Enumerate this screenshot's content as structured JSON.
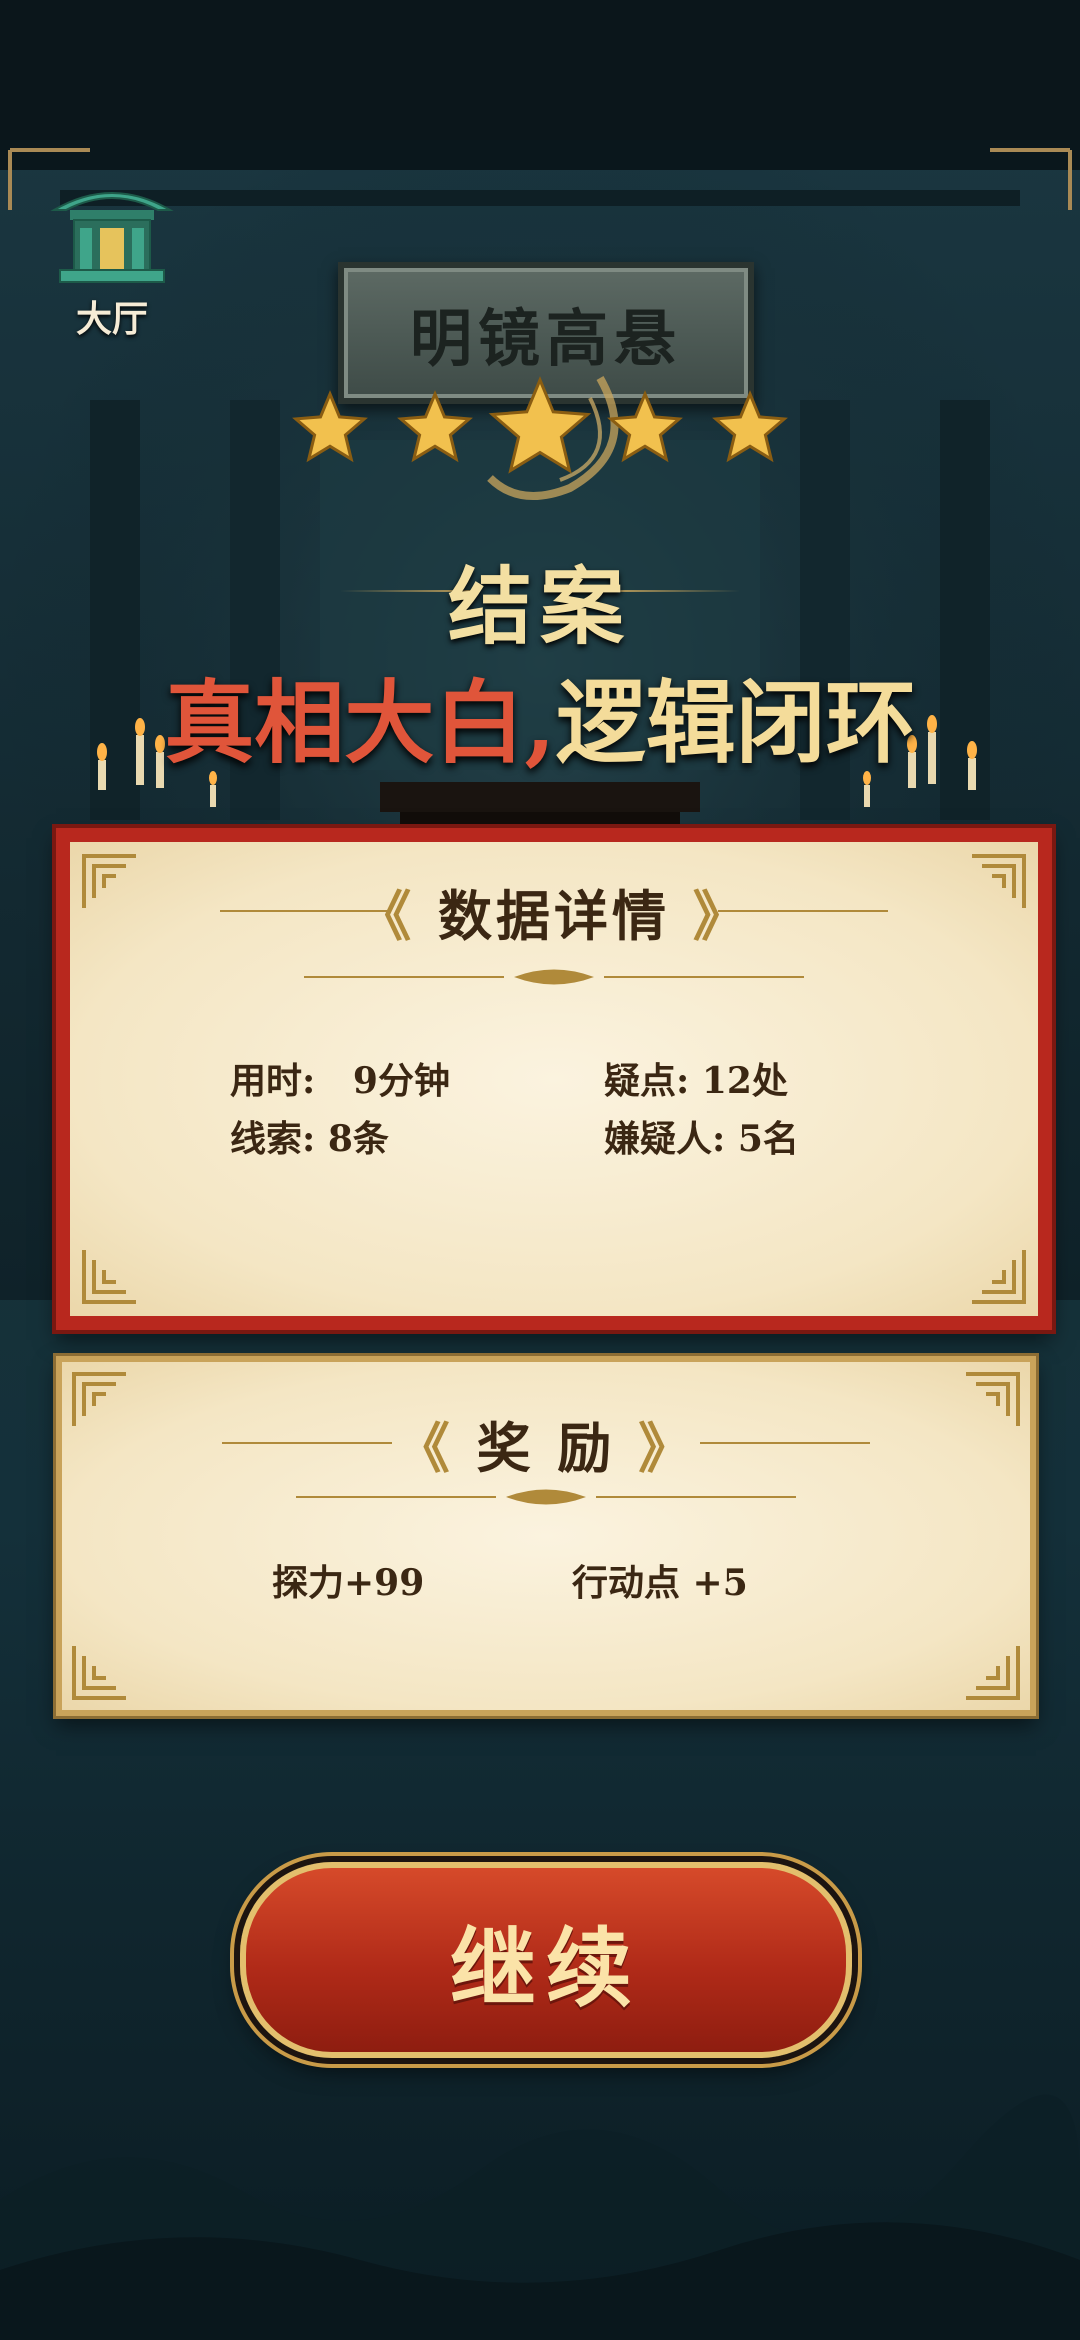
{
  "lobby": {
    "label": "大厅",
    "icon": "temple-icon"
  },
  "plaque": {
    "text": "明镜高悬"
  },
  "rating": {
    "stars": 5,
    "max": 5
  },
  "verdict": {
    "title": "结案",
    "headline_red": "真相大白,",
    "headline_gold": "逻辑闭环"
  },
  "details": {
    "title": "数据详情",
    "stats": [
      {
        "label": "用时:",
        "value": "9分钟"
      },
      {
        "label": "疑点:",
        "value": "12处"
      },
      {
        "label": "线索:",
        "value": "8条"
      },
      {
        "label": "嫌疑人:",
        "value": "5名"
      }
    ]
  },
  "rewards": {
    "title": "奖 励",
    "items": [
      "探力+99",
      "行动点 +5"
    ]
  },
  "continue_button": {
    "label": "继续"
  },
  "colors": {
    "star_gold": "#f2c14e",
    "seal_red": "#b8281e",
    "paper": "#f6ead0",
    "text_brown": "#3b2713"
  }
}
